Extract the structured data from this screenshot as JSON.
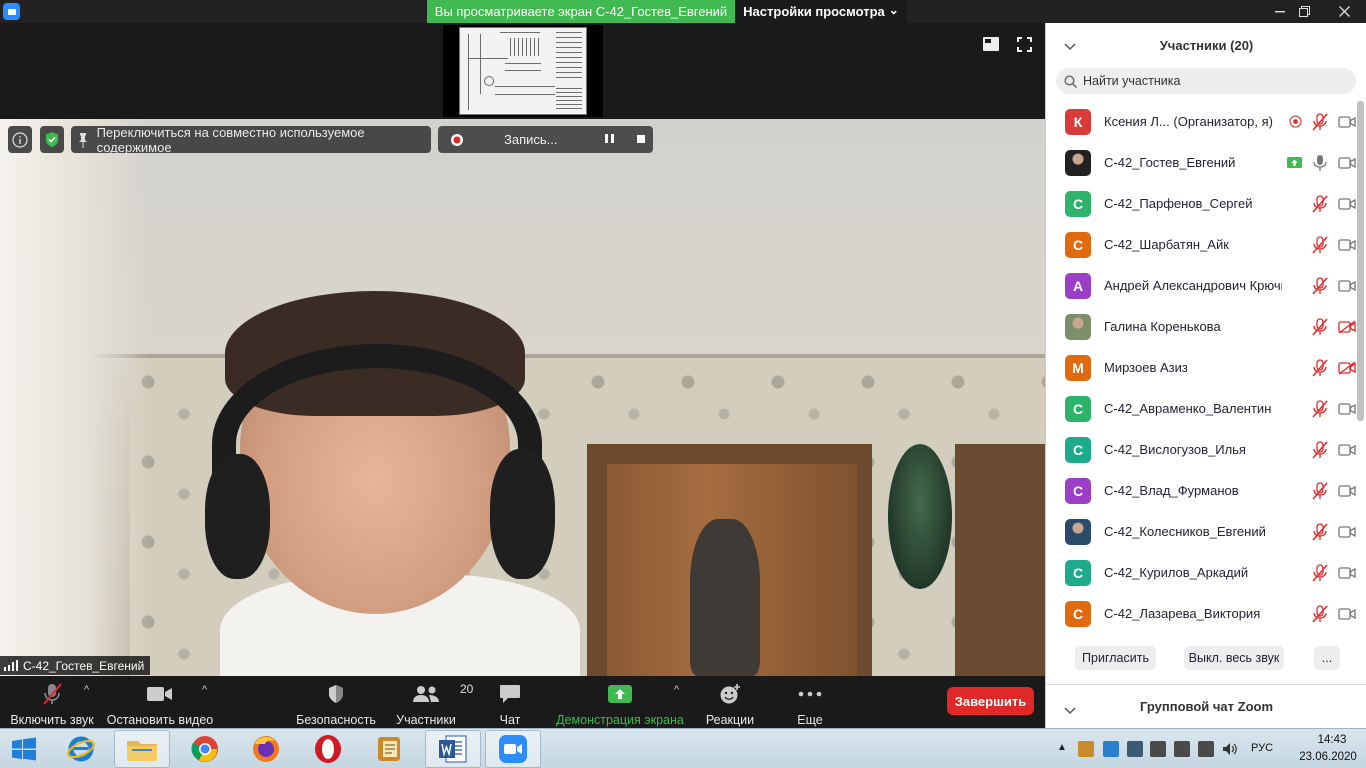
{
  "window": {
    "share_banner": "Вы просматриваете экран С-42_Гостев_Евгений",
    "view_options": "Настройки просмотра",
    "view_options_caret": "⌄"
  },
  "video": {
    "switch_shared_content": "Переключиться на совместно используемое содержимое",
    "recording_label": "Запись...",
    "speaker_name": "С-42_Гостев_Евгений"
  },
  "toolbar": {
    "unmute": "Включить звук",
    "stop_video": "Остановить видео",
    "security": "Безопасность",
    "participants": "Участники",
    "participants_count": "20",
    "chat": "Чат",
    "share_screen": "Демонстрация экрана",
    "reactions": "Реакции",
    "more": "Еще",
    "end": "Завершить",
    "accent_green": "#3fb950",
    "end_color": "#e02828"
  },
  "panel": {
    "title": "Участники (20)",
    "search_placeholder": "Найти участника",
    "participants": [
      {
        "initial": "К",
        "name": "Ксения Л...  (Организатор, я)",
        "color": "#d93a3a",
        "avatar": "letter",
        "host": true,
        "mic": "muted",
        "video": "off"
      },
      {
        "initial": "",
        "name": "С-42_Гостев_Евгений",
        "color": "#222222",
        "avatar": "photo",
        "sharing": true,
        "mic": "on",
        "video": "off"
      },
      {
        "initial": "С",
        "name": "С-42_Парфенов_Сергей",
        "color": "#2db36a",
        "avatar": "letter",
        "mic": "muted",
        "video": "off"
      },
      {
        "initial": "С",
        "name": "С-42_Шарбатян_Айк",
        "color": "#e06a10",
        "avatar": "letter",
        "mic": "muted",
        "video": "off"
      },
      {
        "initial": "А",
        "name": "Андрей Александрович Крючк...",
        "color": "#9b3fc6",
        "avatar": "letter",
        "mic": "muted",
        "video": "off"
      },
      {
        "initial": "",
        "name": "Галина Коренькова",
        "color": "#7a8f6a",
        "avatar": "photo",
        "mic": "muted",
        "video": "blocked"
      },
      {
        "initial": "М",
        "name": "Мирзоев Азиз",
        "color": "#e06a10",
        "avatar": "letter",
        "mic": "muted",
        "video": "blocked"
      },
      {
        "initial": "С",
        "name": "С-42_Авраменко_Валентин",
        "color": "#2db36a",
        "avatar": "letter",
        "mic": "muted",
        "video": "off"
      },
      {
        "initial": "С",
        "name": "С-42_Вислогузов_Илья",
        "color": "#1eaa8c",
        "avatar": "letter",
        "mic": "muted",
        "video": "off"
      },
      {
        "initial": "С",
        "name": "С-42_Влад_Фурманов",
        "color": "#9b3fc6",
        "avatar": "letter",
        "mic": "muted",
        "video": "off"
      },
      {
        "initial": "",
        "name": "С-42_Колесников_Евгений",
        "color": "#2a4a6a",
        "avatar": "photo",
        "mic": "muted",
        "video": "off"
      },
      {
        "initial": "С",
        "name": "С-42_Курилов_Аркадий",
        "color": "#1eaa8c",
        "avatar": "letter",
        "mic": "muted",
        "video": "off"
      },
      {
        "initial": "С",
        "name": "С-42_Лазарева_Виктория",
        "color": "#e06a10",
        "avatar": "letter",
        "mic": "muted",
        "video": "off"
      }
    ],
    "invite": "Пригласить",
    "mute_all": "Выкл. весь звук",
    "more": "...",
    "chat_title": "Групповой чат Zoom"
  },
  "taskbar": {
    "apps": [
      "windows-start",
      "internet-explorer",
      "file-explorer",
      "chrome",
      "firefox",
      "opera",
      "notes-app",
      "word",
      "zoom"
    ],
    "language": "РУС",
    "time": "14:43",
    "date": "23.06.2020"
  }
}
